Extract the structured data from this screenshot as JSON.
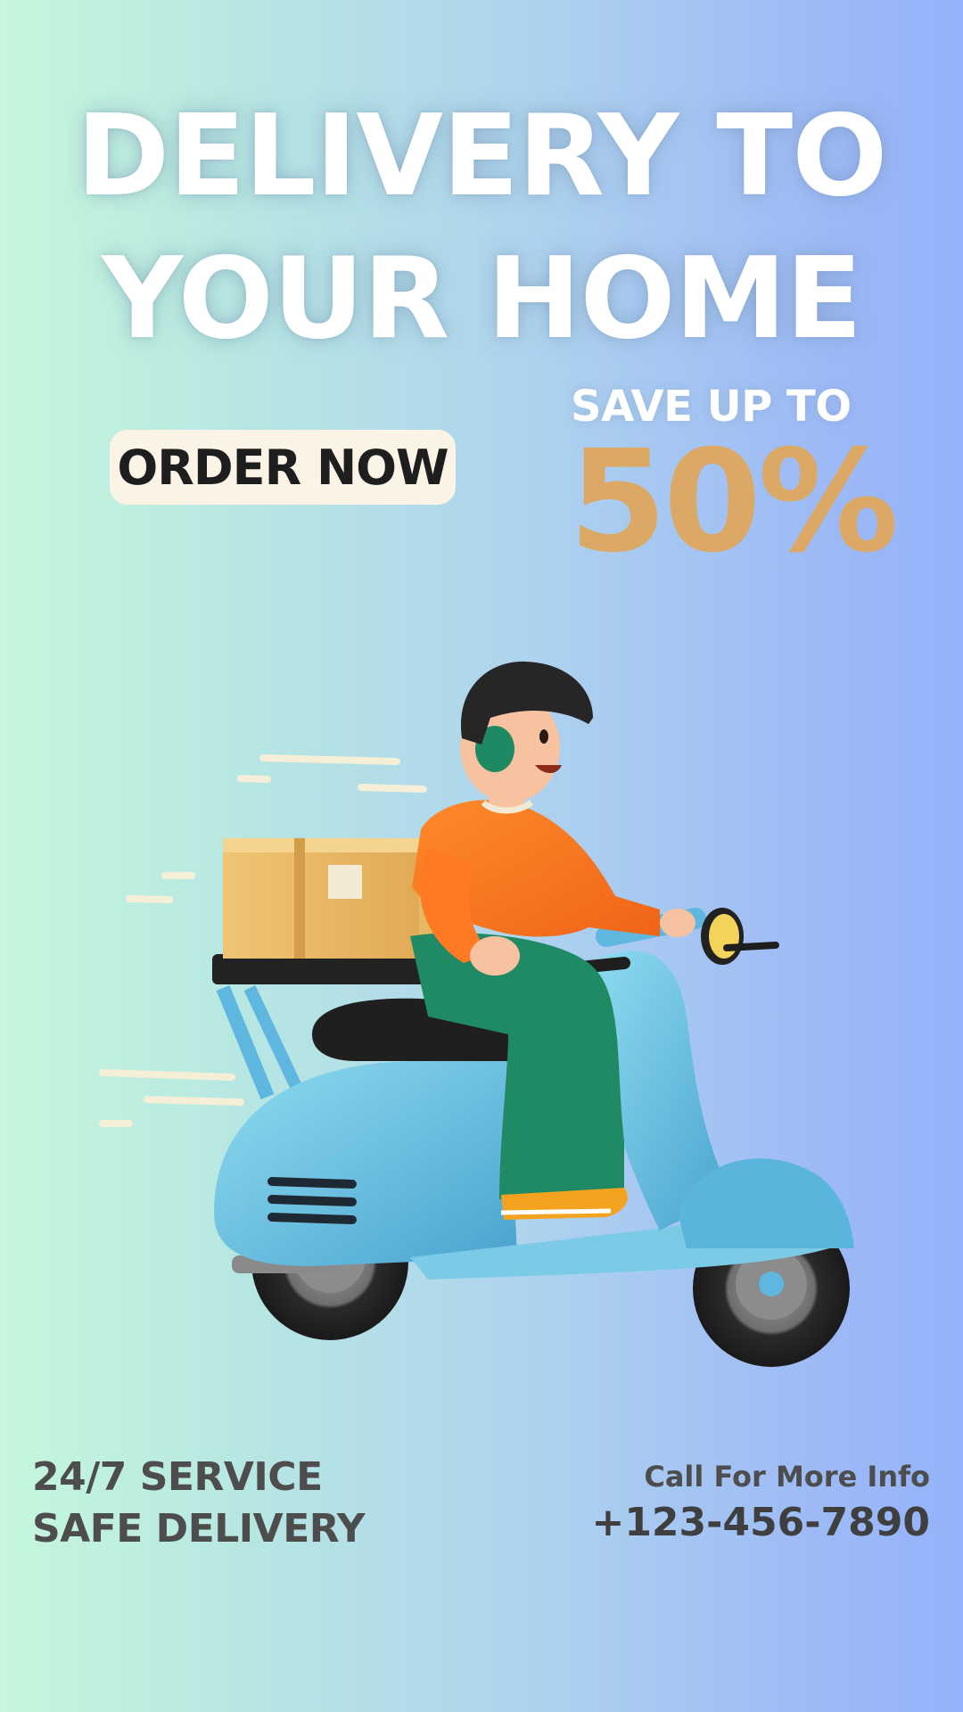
{
  "headline": {
    "line1": "DELIVERY TO",
    "line2": "YOUR HOME"
  },
  "cta": {
    "order_label": "ORDER NOW"
  },
  "promo": {
    "save_label": "SAVE UP TO",
    "percent": "50%"
  },
  "illustration": {
    "icon": "delivery-scooter-rider-illustration"
  },
  "features": {
    "line1": "24/7 SERVICE",
    "line2": "SAFE DELIVERY"
  },
  "contact": {
    "info_label": "Call For More Info",
    "phone": "+123-456-7890"
  },
  "colors": {
    "accent": "#dba965",
    "button_bg": "#fbf3e6",
    "text_dark": "#4d4d4d"
  }
}
